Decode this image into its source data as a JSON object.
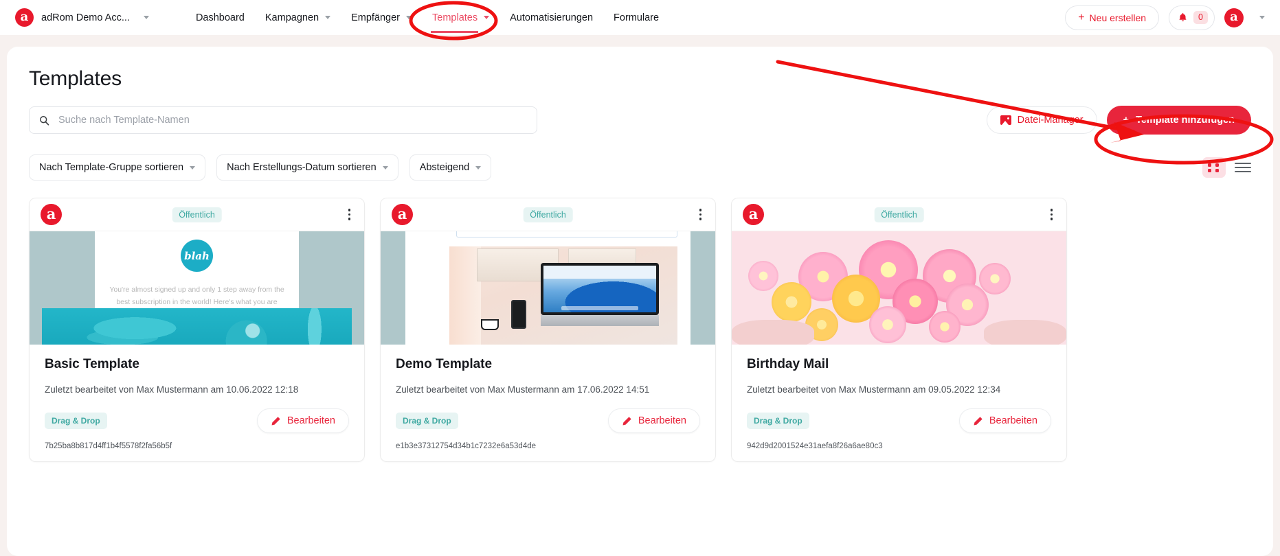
{
  "topnav": {
    "logo_letter": "a",
    "account_name": "adRom Demo Acc...",
    "menu": [
      {
        "label": "Dashboard",
        "has_caret": false,
        "active": false
      },
      {
        "label": "Kampagnen",
        "has_caret": true,
        "active": false
      },
      {
        "label": "Empfänger",
        "has_caret": true,
        "active": false
      },
      {
        "label": "Templates",
        "has_caret": true,
        "active": true
      },
      {
        "label": "Automatisierungen",
        "has_caret": false,
        "active": false
      },
      {
        "label": "Formulare",
        "has_caret": false,
        "active": false
      }
    ],
    "create_button": "Neu erstellen",
    "notification_count": "0",
    "avatar_letter": "a"
  },
  "page": {
    "title": "Templates"
  },
  "search": {
    "placeholder": "Suche nach Template-Namen",
    "value": ""
  },
  "actions": {
    "file_manager": "Datei-Manager",
    "add_template": "Template hinzufügen",
    "plus": "+"
  },
  "filters": [
    {
      "label": "Nach Template-Gruppe sortieren"
    },
    {
      "label": "Nach Erstellungs-Datum sortieren"
    },
    {
      "label": "Absteigend"
    }
  ],
  "view_toggle": {
    "grid": "grid-view",
    "list": "list-view",
    "active": "grid"
  },
  "cards": [
    {
      "logo_letter": "a",
      "visibility": "Öffentlich",
      "name": "Basic Template",
      "meta": "Zuletzt bearbeitet von Max Mustermann am 10.06.2022 12:18",
      "type_chip": "Drag & Drop",
      "edit_label": "Bearbeiten",
      "id": "7b25ba8b817d4ff1b4f5578f2fa56b5f",
      "preview_logo_text": "blah",
      "preview_body_text": "You're almost signed up and only 1 step away from the best subscription in the world! Here's what you are missing..."
    },
    {
      "logo_letter": "a",
      "visibility": "Öffentlich",
      "name": "Demo Template",
      "meta": "Zuletzt bearbeitet von Max Mustermann am 17.06.2022 14:51",
      "type_chip": "Drag & Drop",
      "edit_label": "Bearbeiten",
      "id": "e1b3e37312754d34b1c7232e6a53d4de"
    },
    {
      "logo_letter": "a",
      "visibility": "Öffentlich",
      "name": "Birthday Mail",
      "meta": "Zuletzt bearbeitet von Max Mustermann am 09.05.2022 12:34",
      "type_chip": "Drag & Drop",
      "edit_label": "Bearbeiten",
      "id": "942d9d2001524e31aefa8f26a6ae80c3"
    }
  ],
  "annotations": {
    "color": "#ee1111",
    "ellipse_nav_target": "Templates",
    "ellipse_button_target": "Template hinzufügen",
    "arrow": "pointer-arrow"
  },
  "colors": {
    "brand_red": "#e8192c",
    "accent_red": "#e8253c",
    "nav_active": "#eb4b63",
    "teal_chip_bg": "#e7f4f3",
    "teal_chip_text": "#3fa9a2",
    "page_bg": "#f7f1ef",
    "panel_bg": "#ffffff"
  }
}
